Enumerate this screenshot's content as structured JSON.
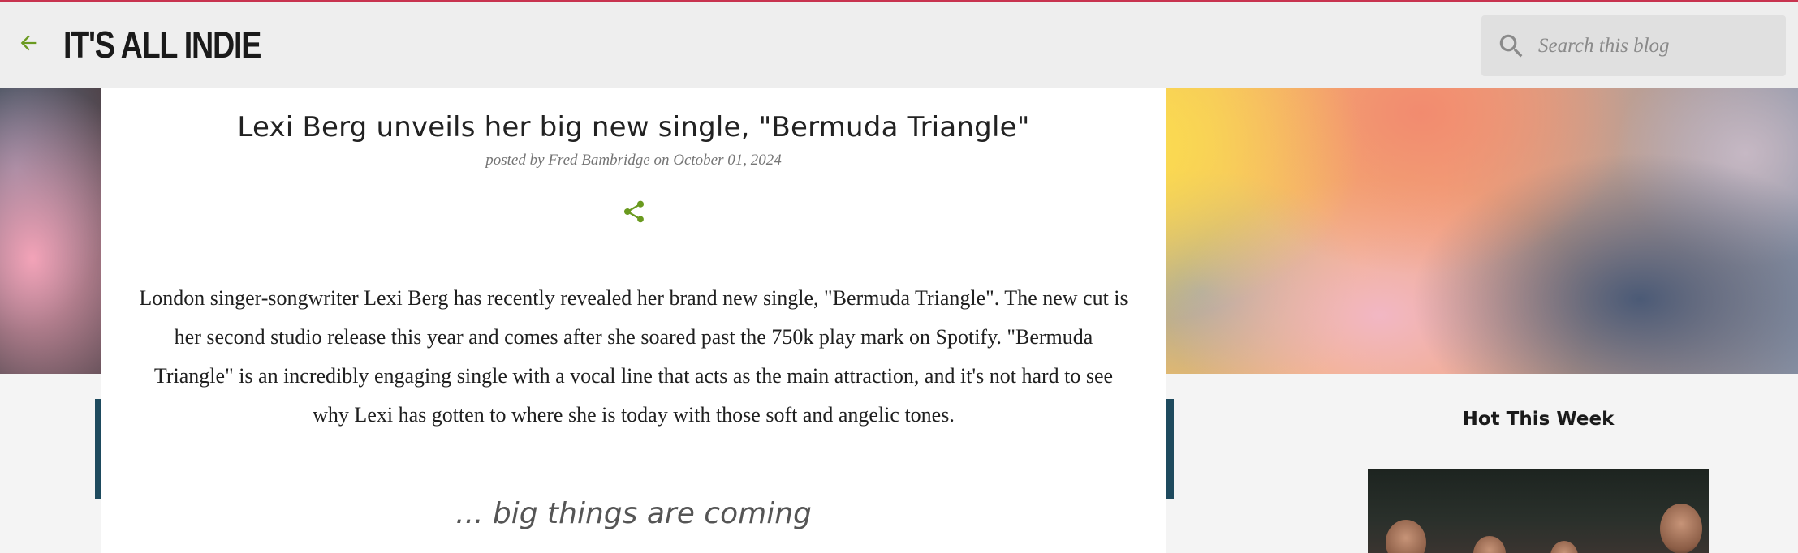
{
  "colors": {
    "accent": "#6a9a1f",
    "top_border": "#c8334f",
    "header_bg": "#eeeeee",
    "page_bg": "#f4f4f4",
    "sidebar_bar": "#1e4a5e"
  },
  "header": {
    "back_icon": "arrow-left-icon",
    "site_title": "IT'S ALL INDIE",
    "search": {
      "icon": "search-icon",
      "placeholder": "Search this blog",
      "value": ""
    }
  },
  "post": {
    "title": "Lexi Berg unveils her big new single, \"Bermuda Triangle\"",
    "meta": {
      "posted_by_label": "posted by",
      "author": "Fred Bambridge",
      "on_label": "on",
      "date": "October 01, 2024"
    },
    "share_icon": "share-icon",
    "body": "London singer-songwriter Lexi Berg has recently revealed her brand new single, \"Bermuda Triangle\". The new cut is her second studio release this year and comes after she soared past the 750k play mark on Spotify. \"Bermuda Triangle\" is an incredibly engaging single with a vocal line that acts as the main attraction, and it's not hard to see why Lexi has gotten to where she is today with those soft and angelic tones.",
    "pullquote": "... big things are coming"
  },
  "sidebar": {
    "widget_title": "Hot This Week"
  }
}
